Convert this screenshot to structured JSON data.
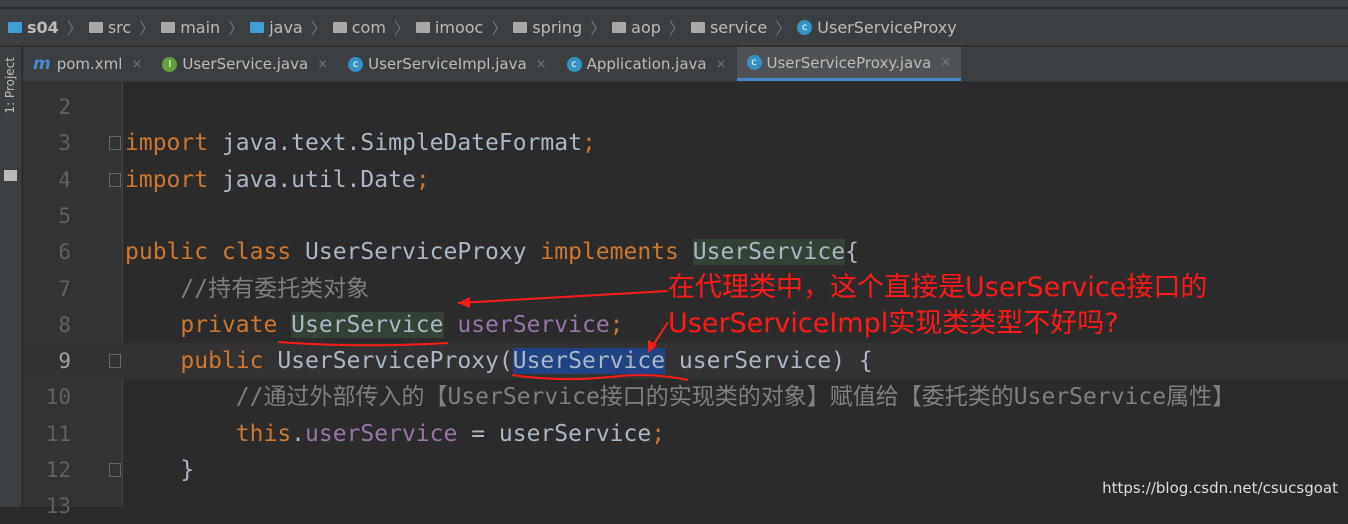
{
  "breadcrumb": [
    "s04",
    "src",
    "main",
    "java",
    "com",
    "imooc",
    "spring",
    "aop",
    "service",
    "UserServiceProxy"
  ],
  "side_label": "1: Project",
  "tabs": [
    {
      "label": "pom.xml",
      "icon": "maven"
    },
    {
      "label": "UserService.java",
      "icon": "interface"
    },
    {
      "label": "UserServiceImpl.java",
      "icon": "class"
    },
    {
      "label": "Application.java",
      "icon": "class"
    },
    {
      "label": "UserServiceProxy.java",
      "icon": "class",
      "active": true
    }
  ],
  "close_glyph": "×",
  "lines": [
    {
      "n": "2",
      "tokens": []
    },
    {
      "n": "3",
      "tokens": [
        {
          "t": "import ",
          "c": "kw"
        },
        {
          "t": "java.text.SimpleDateFormat",
          "c": "id"
        },
        {
          "t": ";",
          "c": "kw"
        }
      ],
      "fold": true
    },
    {
      "n": "4",
      "tokens": [
        {
          "t": "import ",
          "c": "kw"
        },
        {
          "t": "java.util.Date",
          "c": "id"
        },
        {
          "t": ";",
          "c": "kw"
        }
      ],
      "fold": true
    },
    {
      "n": "5",
      "tokens": []
    },
    {
      "n": "6",
      "tokens": [
        {
          "t": "public class ",
          "c": "kw"
        },
        {
          "t": "UserServiceProxy ",
          "c": "id"
        },
        {
          "t": "implements ",
          "c": "kw"
        },
        {
          "t": "UserService",
          "c": "ty"
        },
        {
          "t": "{",
          "c": "id"
        }
      ]
    },
    {
      "n": "7",
      "tokens": [
        {
          "t": "    //持有委托类对象",
          "c": "cm"
        }
      ]
    },
    {
      "n": "8",
      "tokens": [
        {
          "t": "    private ",
          "c": "kw"
        },
        {
          "t": "UserService",
          "c": "ty"
        },
        {
          "t": " userService",
          "c": "fd"
        },
        {
          "t": ";",
          "c": "kw"
        }
      ]
    },
    {
      "n": "9",
      "tokens": [
        {
          "t": "    public ",
          "c": "kw"
        },
        {
          "t": "UserServiceProxy(",
          "c": "id"
        },
        {
          "t": "UserService",
          "c": "sel"
        },
        {
          "t": " userService) {",
          "c": "id"
        }
      ],
      "current": true,
      "fold": true
    },
    {
      "n": "10",
      "tokens": [
        {
          "t": "        //通过外部传入的【UserService接口的实现类的对象】赋值给【委托类的UserService属性】",
          "c": "cm"
        }
      ]
    },
    {
      "n": "11",
      "tokens": [
        {
          "t": "        this",
          "c": "kw"
        },
        {
          "t": ".",
          "c": "id"
        },
        {
          "t": "userService",
          "c": "fd"
        },
        {
          "t": " = userService",
          "c": "id"
        },
        {
          "t": ";",
          "c": "kw"
        }
      ]
    },
    {
      "n": "12",
      "tokens": [
        {
          "t": "    }",
          "c": "id"
        }
      ],
      "fold": true
    },
    {
      "n": "13",
      "tokens": []
    }
  ],
  "annotation": {
    "line1": "在代理类中，这个直接是UserService接口的",
    "line2": "UserServiceImpl实现类类型不好吗?",
    "color": "#ff1a1a"
  },
  "watermark": "https://blog.csdn.net/csucsgoat"
}
